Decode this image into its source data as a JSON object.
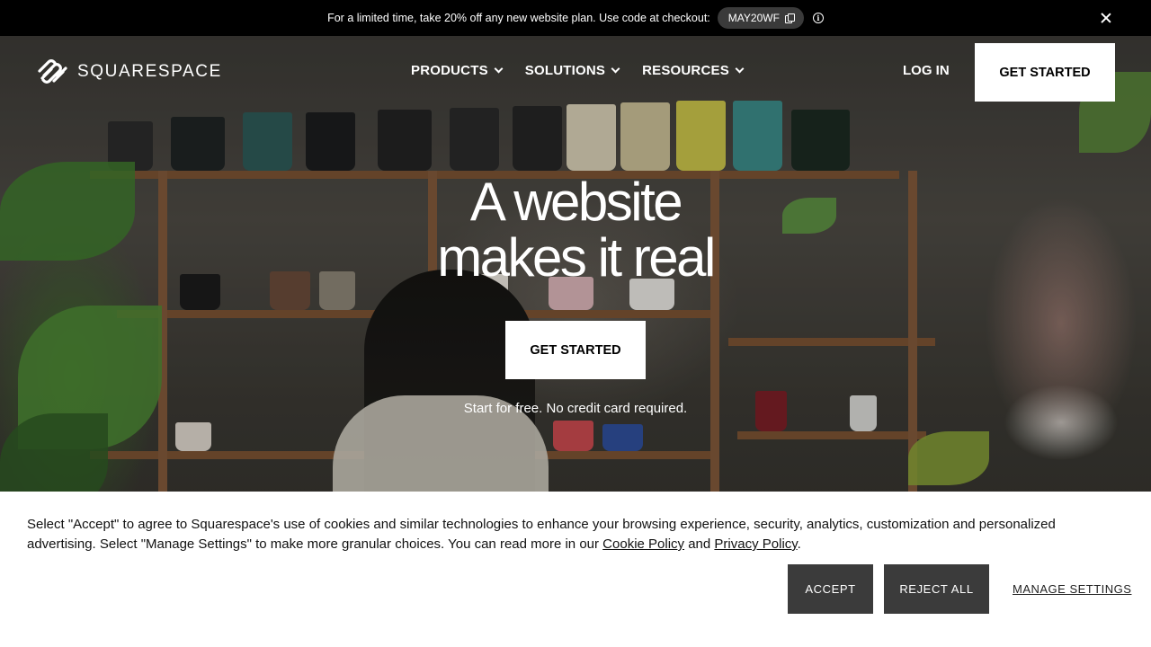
{
  "promo": {
    "text": "For a limited time, take 20% off any new website plan. Use code at checkout:",
    "code": "MAY20WF"
  },
  "nav": {
    "brand": "SQUARESPACE",
    "items": [
      {
        "label": "PRODUCTS"
      },
      {
        "label": "SOLUTIONS"
      },
      {
        "label": "RESOURCES"
      }
    ],
    "login": "LOG IN",
    "cta": "GET STARTED"
  },
  "hero": {
    "headline_line1": "A website",
    "headline_line2": "makes it real",
    "cta": "GET STARTED",
    "subtext": "Start for free. No credit card required."
  },
  "cookie": {
    "text_part1": "Select \"Accept\" to agree to Squarespace's use of cookies and similar technologies to enhance your browsing experience, security, analytics, customization and personalized advertising. Select \"Manage Settings\" to make more granular choices. You can read more in our ",
    "cookie_policy": "Cookie Policy",
    "text_and": " and ",
    "privacy_policy": "Privacy Policy",
    "text_end": ".",
    "accept": "ACCEPT",
    "reject": "REJECT ALL",
    "manage": "MANAGE SETTINGS"
  },
  "colors": {
    "promo_bg": "#000000",
    "code_pill": "#3a3a3a",
    "button_dark": "#3b3b3b",
    "white": "#ffffff"
  }
}
